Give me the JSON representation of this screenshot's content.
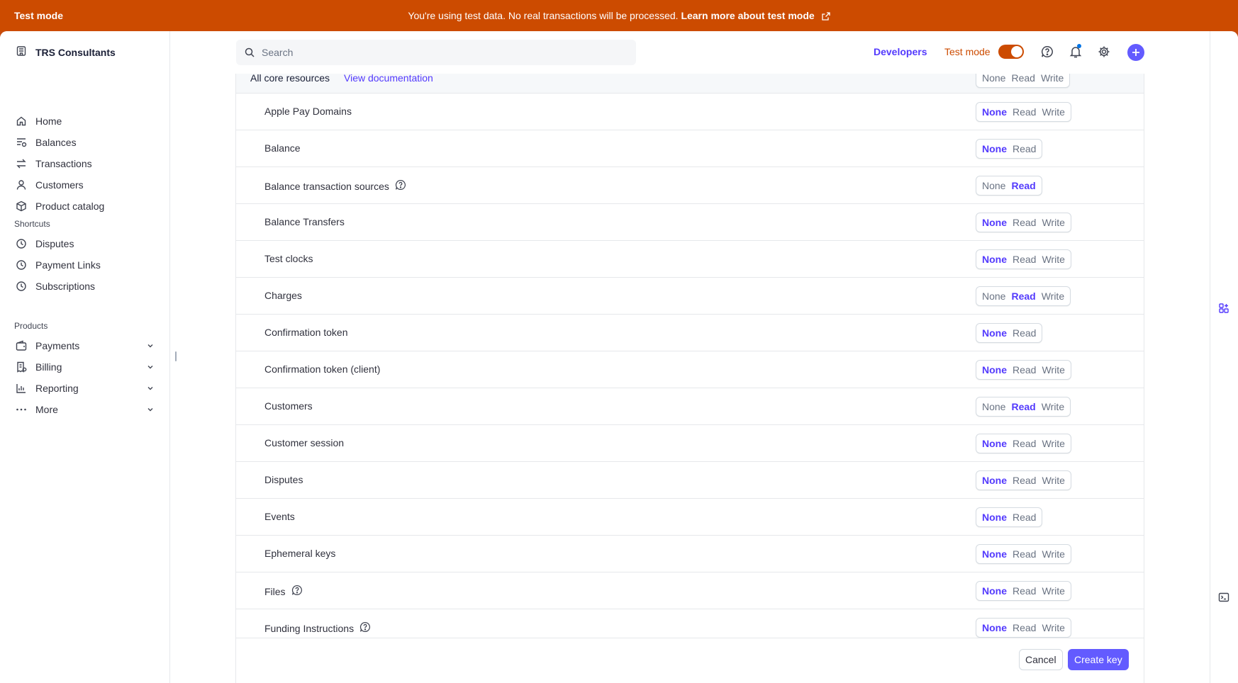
{
  "banner": {
    "label": "Test mode",
    "message": "You're using test data. No real transactions will be processed.",
    "link": "Learn more about test mode"
  },
  "sidebar": {
    "account": "TRS Consultants",
    "items": [
      {
        "label": "Home",
        "icon": "home-icon"
      },
      {
        "label": "Balances",
        "icon": "balances-icon"
      },
      {
        "label": "Transactions",
        "icon": "transactions-icon"
      },
      {
        "label": "Customers",
        "icon": "customer-icon"
      },
      {
        "label": "Product catalog",
        "icon": "box-icon"
      }
    ],
    "shortcuts_label": "Shortcuts",
    "shortcuts": [
      {
        "label": "Disputes",
        "icon": "clock-icon"
      },
      {
        "label": "Payment Links",
        "icon": "clock-icon"
      },
      {
        "label": "Subscriptions",
        "icon": "clock-icon"
      }
    ],
    "products_label": "Products",
    "products": [
      {
        "label": "Payments",
        "icon": "wallet-icon"
      },
      {
        "label": "Billing",
        "icon": "billing-icon"
      },
      {
        "label": "Reporting",
        "icon": "chart-icon"
      },
      {
        "label": "More",
        "icon": "more-icon"
      }
    ]
  },
  "topbar": {
    "search_placeholder": "Search",
    "developers": "Developers",
    "test_mode": "Test mode",
    "test_mode_on": true
  },
  "permissions": {
    "header_title": "All core resources",
    "header_link": "View documentation",
    "header_options": [
      "None",
      "Read",
      "Write"
    ],
    "rows": [
      {
        "name": "Apple Pay Domains",
        "help": false,
        "options": [
          "None",
          "Read",
          "Write"
        ],
        "selected": "None"
      },
      {
        "name": "Balance",
        "help": false,
        "options": [
          "None",
          "Read"
        ],
        "selected": "None"
      },
      {
        "name": "Balance transaction sources",
        "help": true,
        "options": [
          "None",
          "Read"
        ],
        "selected": "Read"
      },
      {
        "name": "Balance Transfers",
        "help": false,
        "options": [
          "None",
          "Read",
          "Write"
        ],
        "selected": "None"
      },
      {
        "name": "Test clocks",
        "help": false,
        "options": [
          "None",
          "Read",
          "Write"
        ],
        "selected": "None"
      },
      {
        "name": "Charges",
        "help": false,
        "options": [
          "None",
          "Read",
          "Write"
        ],
        "selected": "Read"
      },
      {
        "name": "Confirmation token",
        "help": false,
        "options": [
          "None",
          "Read"
        ],
        "selected": "None"
      },
      {
        "name": "Confirmation token (client)",
        "help": false,
        "options": [
          "None",
          "Read",
          "Write"
        ],
        "selected": "None"
      },
      {
        "name": "Customers",
        "help": false,
        "options": [
          "None",
          "Read",
          "Write"
        ],
        "selected": "Read"
      },
      {
        "name": "Customer session",
        "help": false,
        "options": [
          "None",
          "Read",
          "Write"
        ],
        "selected": "None"
      },
      {
        "name": "Disputes",
        "help": false,
        "options": [
          "None",
          "Read",
          "Write"
        ],
        "selected": "None"
      },
      {
        "name": "Events",
        "help": false,
        "options": [
          "None",
          "Read"
        ],
        "selected": "None"
      },
      {
        "name": "Ephemeral keys",
        "help": false,
        "options": [
          "None",
          "Read",
          "Write"
        ],
        "selected": "None"
      },
      {
        "name": "Files",
        "help": true,
        "options": [
          "None",
          "Read",
          "Write"
        ],
        "selected": "None"
      },
      {
        "name": "Funding Instructions",
        "help": true,
        "options": [
          "None",
          "Read",
          "Write"
        ],
        "selected": "None"
      }
    ]
  },
  "footer": {
    "cancel": "Cancel",
    "create": "Create key"
  },
  "colors": {
    "banner": "#cc4b00",
    "accent": "#533afd",
    "button": "#635bff"
  }
}
